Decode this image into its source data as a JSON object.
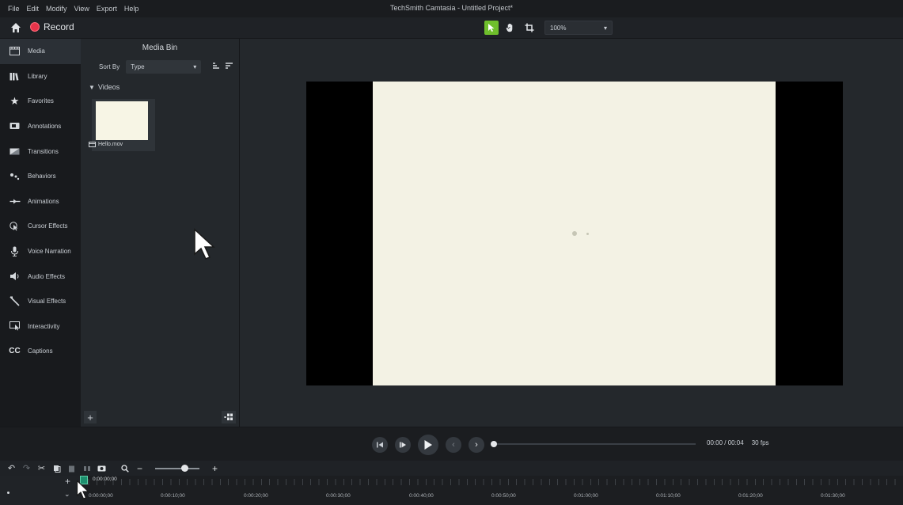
{
  "window": {
    "title": "TechSmith Camtasia - Untitled Project*"
  },
  "menu": [
    "File",
    "Edit",
    "Modify",
    "View",
    "Export",
    "Help"
  ],
  "toolbar": {
    "record_label": "Record",
    "zoom_value": "100%"
  },
  "sidebar": {
    "items": [
      {
        "label": "Media",
        "icon": "media-icon",
        "active": true
      },
      {
        "label": "Library",
        "icon": "library-icon"
      },
      {
        "label": "Favorites",
        "icon": "star-icon"
      },
      {
        "label": "Annotations",
        "icon": "annotations-icon"
      },
      {
        "label": "Transitions",
        "icon": "transitions-icon"
      },
      {
        "label": "Behaviors",
        "icon": "behaviors-icon"
      },
      {
        "label": "Animations",
        "icon": "animations-icon"
      },
      {
        "label": "Cursor Effects",
        "icon": "cursor-effects-icon"
      },
      {
        "label": "Voice Narration",
        "icon": "microphone-icon"
      },
      {
        "label": "Audio Effects",
        "icon": "speaker-icon"
      },
      {
        "label": "Visual Effects",
        "icon": "wand-icon"
      },
      {
        "label": "Interactivity",
        "icon": "interactivity-icon"
      },
      {
        "label": "Captions",
        "icon": "captions-icon"
      }
    ]
  },
  "media_bin": {
    "title": "Media Bin",
    "sort_label": "Sort By",
    "sort_value": "Type",
    "group": "Videos",
    "clip_name": "Hello.mov"
  },
  "playback": {
    "time": "00:00 / 00:04",
    "fps": "30 fps"
  },
  "timeline": {
    "playhead_time": "0:00:00;00",
    "tick_labels": [
      "0:00:00;00",
      "0:00:10;00",
      "0:00:20;00",
      "0:00:30;00",
      "0:00:40;00",
      "0:00:50;00",
      "0:01:00;00",
      "0:01:10;00",
      "0:01:20;00",
      "0:01:30;00"
    ]
  },
  "colors": {
    "accent_green": "#6fbf2c",
    "record_red": "#e8344a",
    "canvas": "#f3f2e4"
  }
}
